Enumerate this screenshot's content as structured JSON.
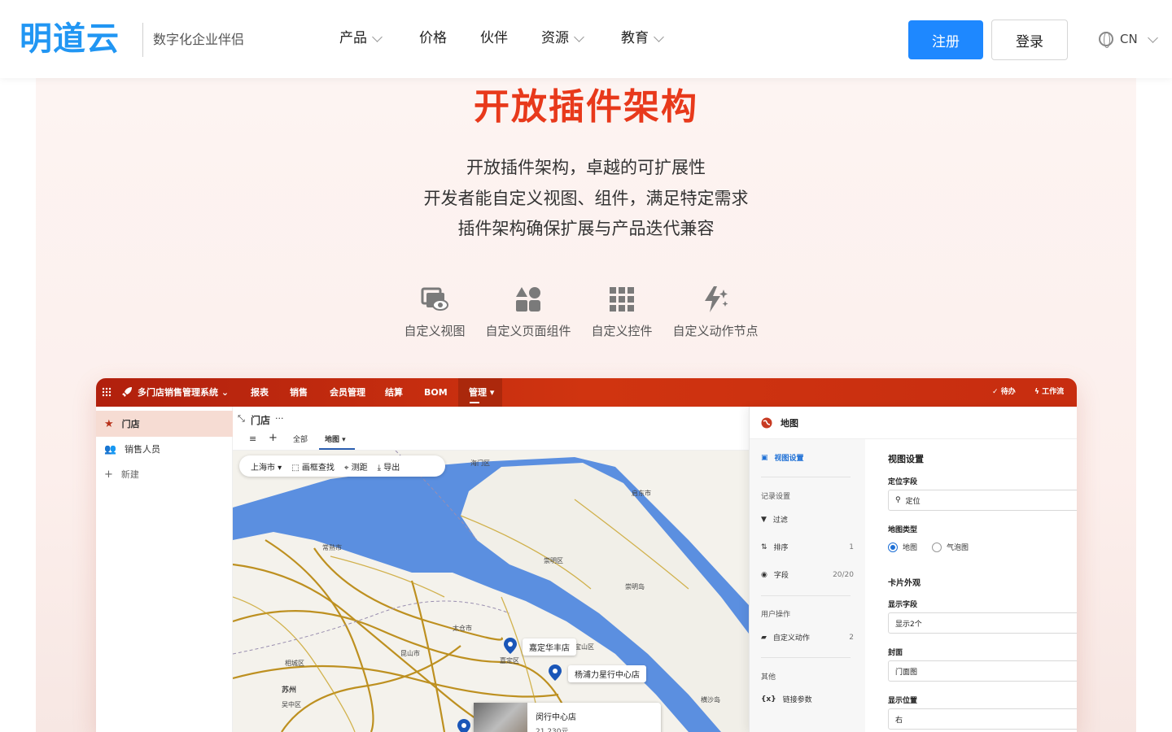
{
  "brand": {
    "logo": "明道云",
    "slogan": "数字化企业伴侣"
  },
  "nav": {
    "items": [
      {
        "label": "产品",
        "dropdown": true
      },
      {
        "label": "价格",
        "dropdown": false
      },
      {
        "label": "伙伴",
        "dropdown": false
      },
      {
        "label": "资源",
        "dropdown": true
      },
      {
        "label": "教育",
        "dropdown": true
      }
    ],
    "register": "注册",
    "login": "登录",
    "lang": "CN"
  },
  "hero": {
    "title": "开放插件架构",
    "lines": [
      "开放插件架构，卓越的可扩展性",
      "开发者能自定义视图、组件，满足特定需求",
      "插件架构确保扩展与产品迭代兼容"
    ],
    "features": [
      {
        "label": "自定义视图",
        "icon": "custom-view-icon"
      },
      {
        "label": "自定义页面组件",
        "icon": "custom-component-icon"
      },
      {
        "label": "自定义控件",
        "icon": "custom-control-icon"
      },
      {
        "label": "自定义动作节点",
        "icon": "custom-action-icon"
      }
    ]
  },
  "app": {
    "title": "多门店销售管理系统",
    "menu": [
      "报表",
      "销售",
      "会员管理",
      "结算",
      "BOM",
      "管理"
    ],
    "right": {
      "todo": "待办",
      "workflow": "工作流"
    },
    "sidebar": [
      "门店",
      "销售人员",
      "新建"
    ],
    "worksheet": {
      "title": "门店",
      "more": "···",
      "views": [
        "全部",
        "地图"
      ]
    },
    "map": {
      "tools": [
        "上海市",
        "画框查找",
        "测距",
        "导出"
      ],
      "pins": [
        "嘉定华丰店",
        "杨浦力星行中心店",
        "闵行中心店"
      ],
      "card_value": "21,230元",
      "places": [
        "海门区",
        "启东市",
        "常熟市",
        "崇明区",
        "崇明岛",
        "太仓市",
        "昆山市",
        "相城区",
        "苏州",
        "吴中区",
        "嘉定区",
        "宝山区",
        "横沙岛"
      ]
    },
    "settings": {
      "title": "地图",
      "nav": {
        "view_settings": "视图设置",
        "record_group": "记录设置",
        "filter": "过滤",
        "sort": "排序",
        "sort_count": "1",
        "fields": "字段",
        "fields_count": "20/20",
        "user_group": "用户操作",
        "custom_action": "自定义动作",
        "custom_action_count": "2",
        "other_group": "其他",
        "link_params": "链接参数"
      },
      "form": {
        "header": "视图设置",
        "locate_label": "定位字段",
        "locate_value": "定位",
        "map_type_label": "地图类型",
        "map_type_options": [
          "地图",
          "气泡图"
        ],
        "card_header": "卡片外观",
        "display_field_label": "显示字段",
        "display_field_value": "显示2个",
        "cover_label": "封面",
        "cover_value": "门面图",
        "position_label": "显示位置",
        "position_value": "右"
      }
    }
  },
  "colors": {
    "brand_blue": "#2196f3",
    "accent_red": "#e8391b",
    "button_blue": "#1e88ff",
    "app_bar": "#c72d10",
    "water": "#5b8fe0"
  }
}
